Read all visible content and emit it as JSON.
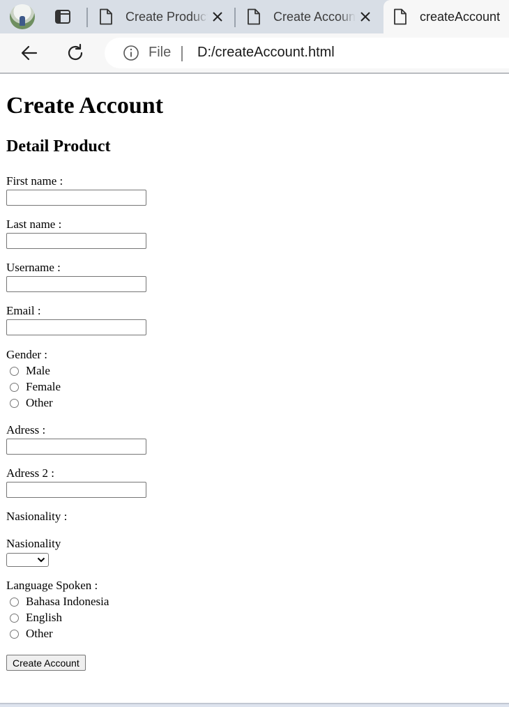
{
  "browser": {
    "tabs": [
      {
        "title": "Create Product",
        "active": false
      },
      {
        "title": "Create Account",
        "active": false
      },
      {
        "title": "createAccount",
        "active": true
      }
    ],
    "address": {
      "scheme": "File",
      "url": "D:/createAccount.html"
    }
  },
  "page": {
    "heading": "Create Account",
    "subheading": "Detail Product",
    "fields": {
      "first_name": {
        "label": "First name :",
        "value": ""
      },
      "last_name": {
        "label": "Last name :",
        "value": ""
      },
      "username": {
        "label": "Username :",
        "value": ""
      },
      "email": {
        "label": "Email :",
        "value": ""
      },
      "address": {
        "label": "Adress :",
        "value": ""
      },
      "address2": {
        "label": "Adress 2 :",
        "value": ""
      }
    },
    "gender": {
      "label": "Gender :",
      "options": [
        "Male",
        "Female",
        "Other"
      ]
    },
    "nationality_label": "Nasionality :",
    "nationality_select": {
      "label": "Nasionality",
      "value": ""
    },
    "language": {
      "label": "Language Spoken :",
      "options": [
        "Bahasa Indonesia",
        "English",
        "Other"
      ]
    },
    "submit_label": "Create Account"
  },
  "colors": {
    "tab_strip": "#d8dee6",
    "toolbar": "#f7f7f7",
    "control_border": "#767676"
  }
}
